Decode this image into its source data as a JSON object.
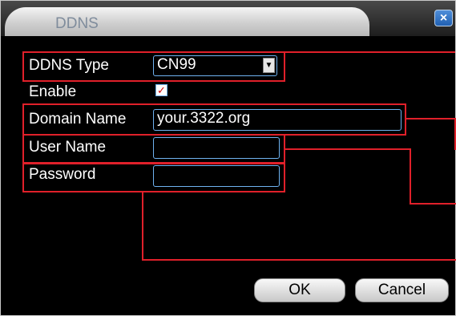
{
  "window": {
    "title": "DDNS",
    "close_label": "×"
  },
  "form": {
    "ddns_type": {
      "label": "DDNS Type",
      "value": "CN99"
    },
    "enable": {
      "label": "Enable",
      "checked": true,
      "check_mark": "✓"
    },
    "domain_name": {
      "label": "Domain Name",
      "value": "your.3322.org"
    },
    "user_name": {
      "label": "User Name",
      "value": ""
    },
    "password": {
      "label": "Password",
      "value": ""
    }
  },
  "buttons": {
    "ok": "OK",
    "cancel": "Cancel"
  },
  "colors": {
    "annotation": "#e0202a",
    "field_border": "#6fb2f0",
    "background": "#000000"
  },
  "icons": {
    "dropdown": "chevron-down-icon",
    "close": "close-icon"
  }
}
